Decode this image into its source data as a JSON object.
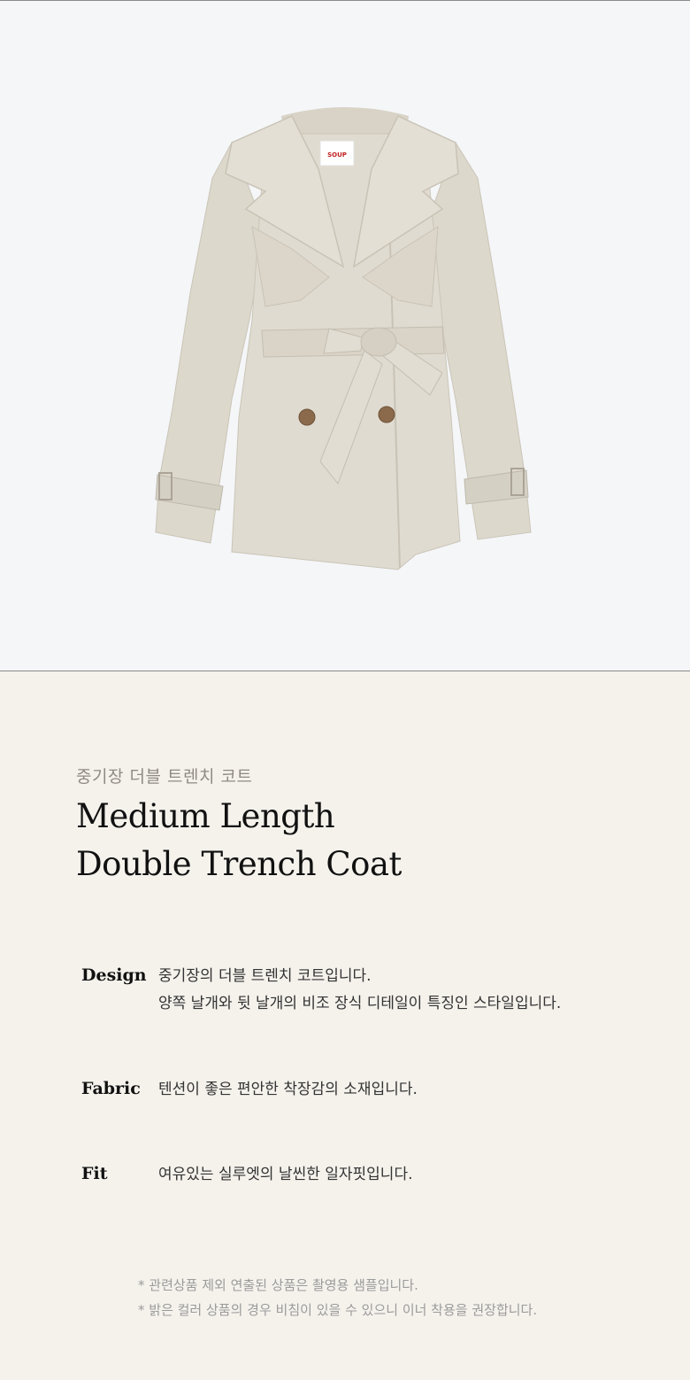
{
  "product_image": {
    "brand_tag": "SOUP",
    "colors": {
      "background": "#f4f6f8",
      "coat": "#e0dbd0",
      "coat_shadow": "#cdc7bb",
      "lining": "#d8d2c6",
      "button": "#8b6a4c",
      "tag_text": "#c0201f"
    }
  },
  "info": {
    "subtitle": "중기장 더블 트렌치 코트",
    "title_line1": "Medium Length",
    "title_line2": "Double Trench Coat"
  },
  "specs": [
    {
      "label": "Design",
      "lines": [
        "중기장의 더블 트렌치 코트입니다.",
        "양쪽 날개와 뒷 날개의 비조 장식 디테일이 특징인 스타일입니다."
      ]
    },
    {
      "label": "Fabric",
      "lines": [
        "텐션이 좋은 편안한 착장감의 소재입니다."
      ]
    },
    {
      "label": "Fit",
      "lines": [
        "여유있는 실루엣의 날씬한 일자핏입니다."
      ]
    }
  ],
  "notes": [
    "* 관련상품 제외 연출된 상품은 촬영용 샘플입니다.",
    "* 밝은 컬러 상품의 경우 비침이 있을 수 있으니 이너 착용을 권장합니다."
  ]
}
